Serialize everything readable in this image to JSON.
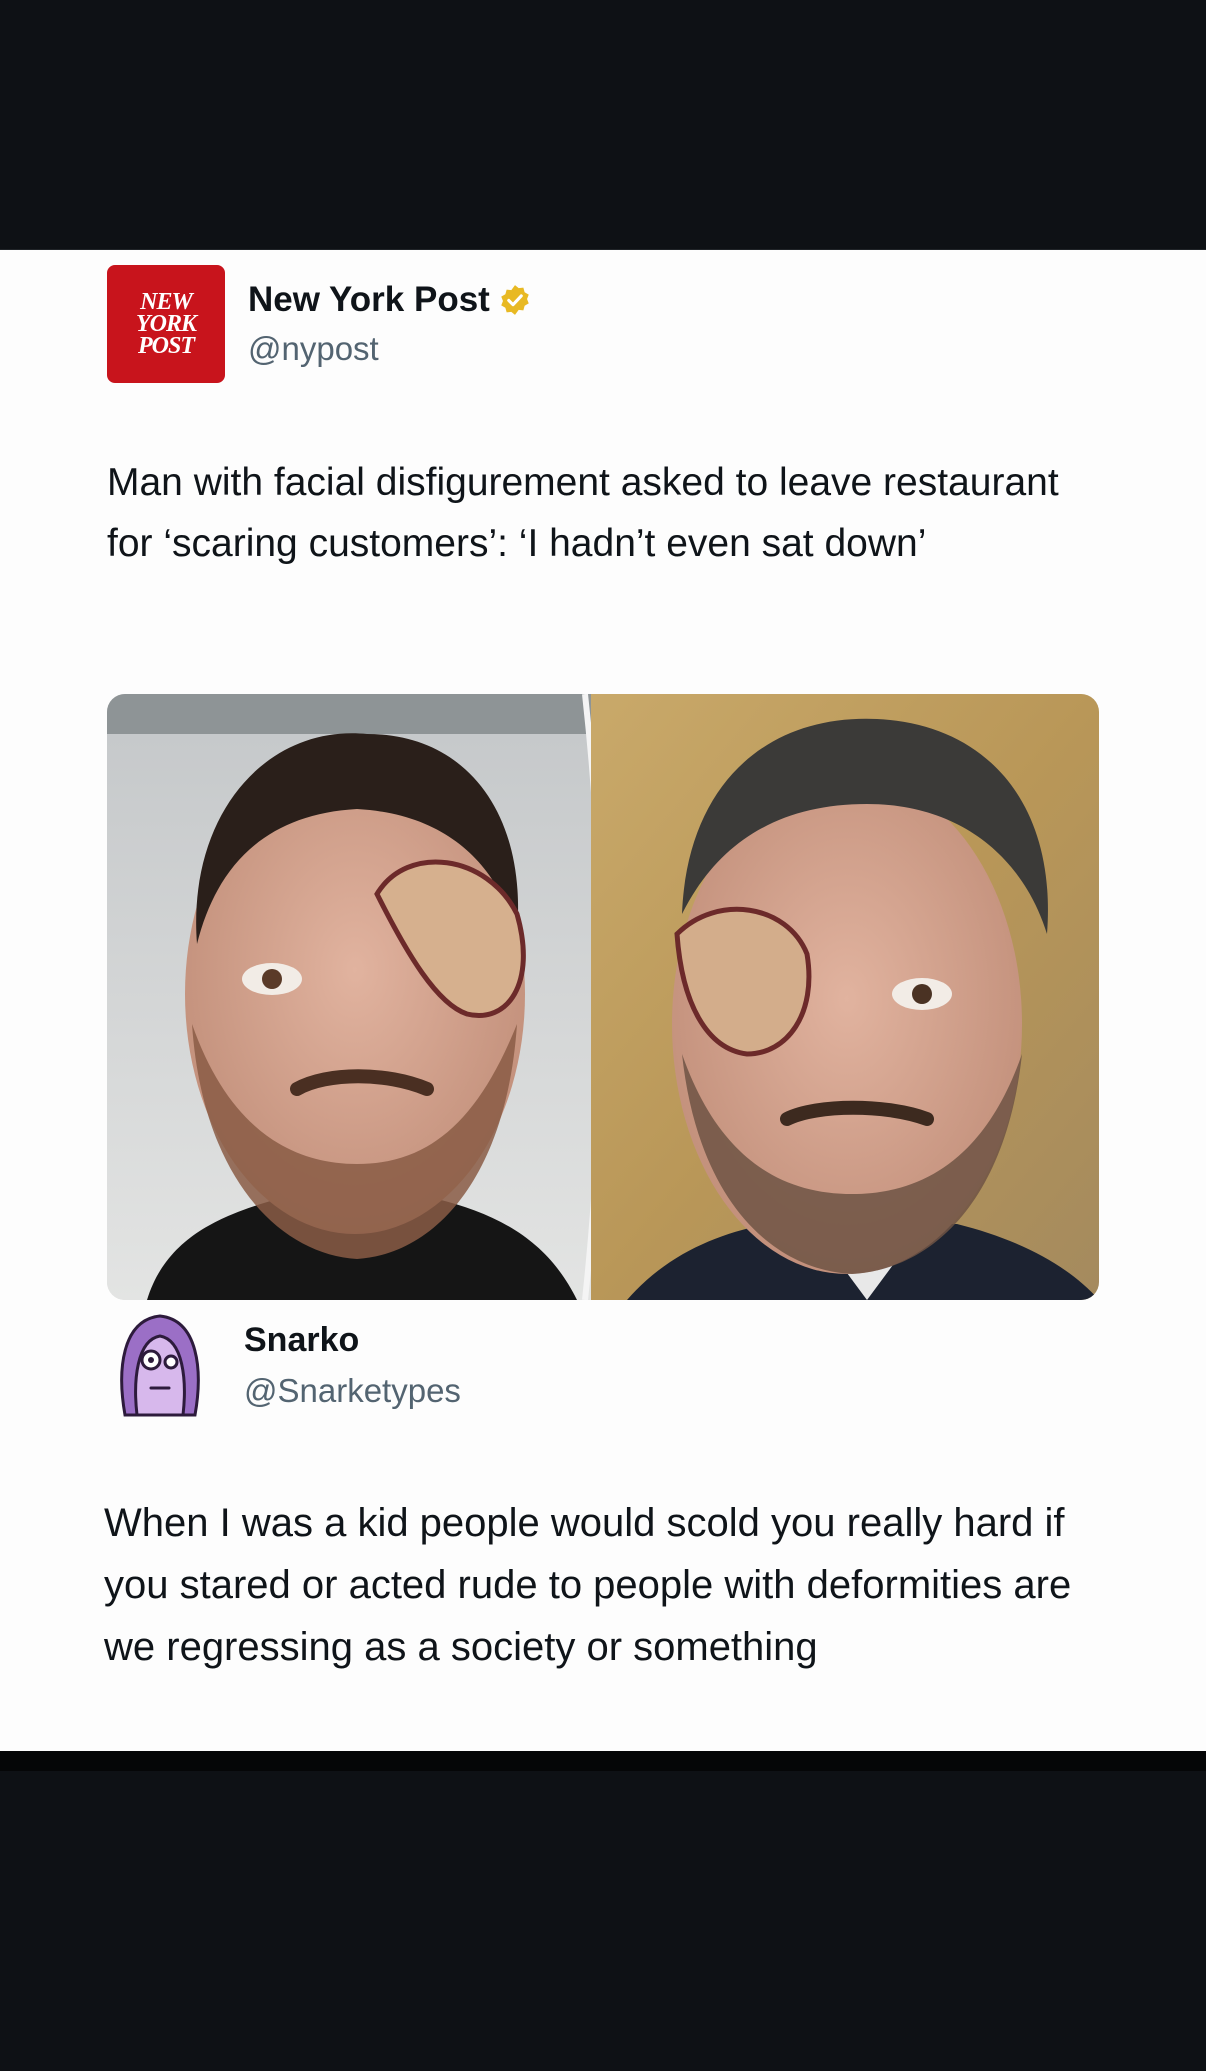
{
  "post": {
    "logo_lines": [
      "NEW",
      "YORK",
      "POST"
    ],
    "display_name": "New York Post",
    "handle": "@nypost",
    "text": "Man with facial disfigurement asked to leave restaurant for ‘scaring customers’: ‘I hadn’t even sat down’",
    "verified_color": "#e8b923",
    "media_icon": "side-by-side-photo-of-man-with-facial-disfigurement"
  },
  "reply": {
    "display_name": "Snarko",
    "handle": "@Snarketypes",
    "text": "When I was a kid people would scold you really hard if you stared or acted rude to people with deformities are we regressing as a society or something",
    "avatar_icon": "purple-cartoon-avatar"
  },
  "colors": {
    "background": "#0e1115",
    "card": "#fdfdfd",
    "brand_red": "#c8141c",
    "handle_gray": "#536471"
  }
}
